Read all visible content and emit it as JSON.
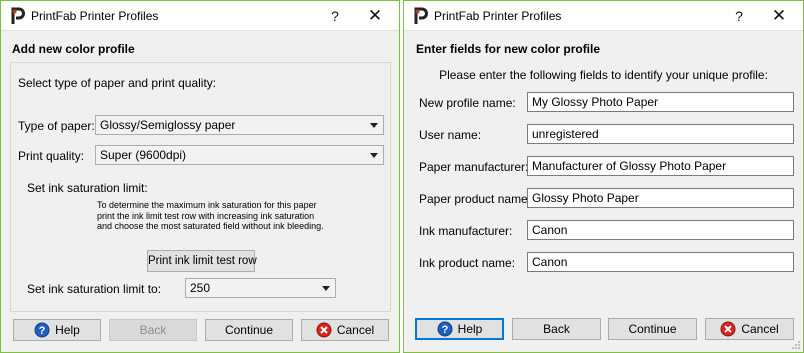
{
  "left": {
    "title": "PrintFab Printer Profiles",
    "help_glyph": "?",
    "close_glyph": "✕",
    "heading": "Add new color profile",
    "group_label": "Select type of paper and print quality:",
    "paper_label": "Type of paper:",
    "paper_value": "Glossy/Semiglossy paper",
    "quality_label": "Print quality:",
    "quality_value": "Super (9600dpi)",
    "ink_limit_heading": "Set ink saturation limit:",
    "ink_info": "To determine the maximum ink saturation for this paper print the ink limit test row with increasing ink saturation and choose the most saturated field without ink bleeding.",
    "print_test_button": "Print ink limit test row",
    "limit_label": "Set ink saturation limit to:",
    "limit_value": "250",
    "buttons": {
      "help": "Help",
      "back": "Back",
      "continue": "Continue",
      "cancel": "Cancel"
    }
  },
  "right": {
    "title": "PrintFab Printer Profiles",
    "help_glyph": "?",
    "close_glyph": "✕",
    "heading": "Enter fields for new color profile",
    "intro": "Please enter the following fields to identify your unique profile:",
    "fields": [
      {
        "label": "New profile name:",
        "value": "My Glossy Photo Paper"
      },
      {
        "label": "User name:",
        "value": "unregistered"
      },
      {
        "label": "Paper manufacturer:",
        "value": "Manufacturer of Glossy Photo Paper"
      },
      {
        "label": "Paper product name:",
        "value": "Glossy Photo Paper"
      },
      {
        "label": "Ink manufacturer:",
        "value": "Canon"
      },
      {
        "label": "Ink product name:",
        "value": "Canon"
      }
    ],
    "buttons": {
      "help": "Help",
      "back": "Back",
      "continue": "Continue",
      "cancel": "Cancel"
    }
  },
  "colors": {
    "window_border": "#7fbf3f",
    "help_icon": "#1f5fbf",
    "cancel_icon": "#d9261c",
    "focus": "#0078d7"
  },
  "icons": [
    "app-p-icon",
    "help-question-icon",
    "close-x-icon",
    "help-circle-icon",
    "cancel-circle-icon",
    "dropdown-arrow-icon"
  ]
}
